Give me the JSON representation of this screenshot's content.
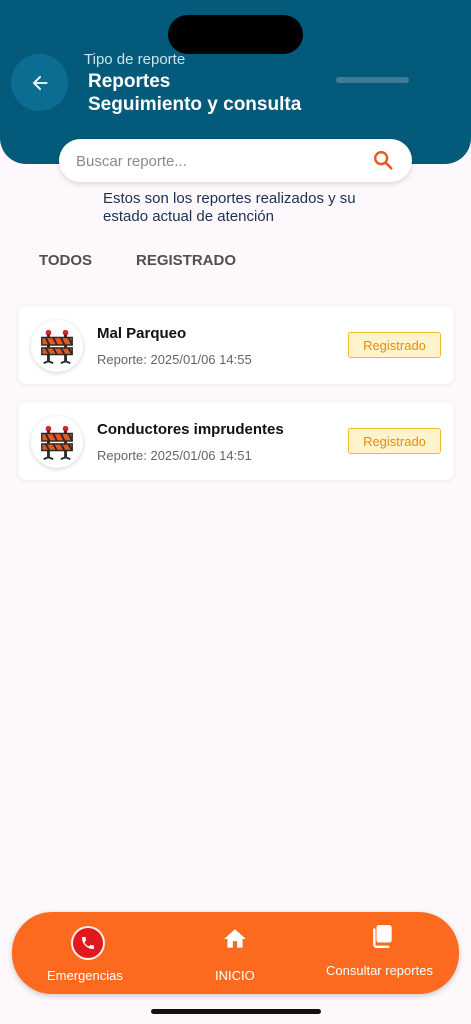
{
  "header": {
    "subtitle": "Tipo de reporte",
    "title_line1": "Reportes",
    "title_line2": "Seguimiento y consulta",
    "background_color": "#045a7a"
  },
  "search": {
    "placeholder": "Buscar reporte...",
    "icon": "search-icon"
  },
  "description": "Estos son los reportes realizados y su estado actual de atención",
  "tabs": [
    {
      "label": "TODOS"
    },
    {
      "label": "REGISTRADO"
    }
  ],
  "reports": [
    {
      "title": "Mal Parqueo",
      "date": "Reporte: 2025/01/06 14:55",
      "status": "Registrado",
      "icon": "road-barrier-icon"
    },
    {
      "title": "Conductores imprudentes",
      "date": "Reporte: 2025/01/06 14:51",
      "status": "Registrado",
      "icon": "road-barrier-icon"
    }
  ],
  "bottom_nav": {
    "items": [
      {
        "label": "Emergencias",
        "icon": "phone-icon"
      },
      {
        "label": "INICIO",
        "icon": "home-icon"
      },
      {
        "label": "Consultar reportes",
        "icon": "documents-icon",
        "active": true
      }
    ],
    "background_color": "#fb6a1f"
  }
}
